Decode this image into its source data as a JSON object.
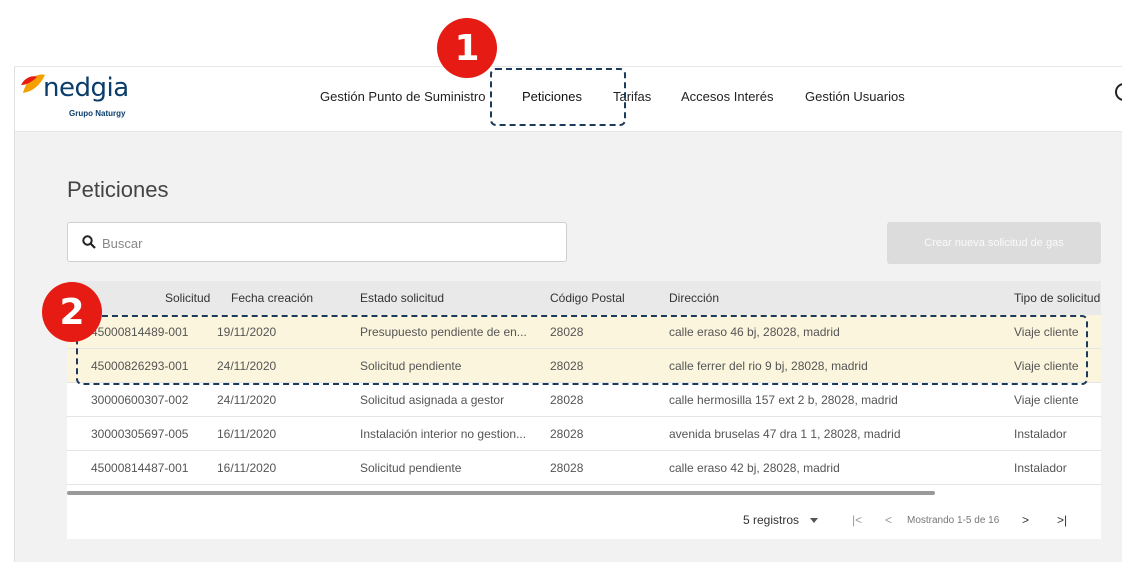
{
  "header": {
    "logo_text": "nedgia",
    "logo_subtext": "Grupo Naturgy",
    "nav": [
      {
        "label": "Gestión Punto de Suministro"
      },
      {
        "label": "Peticiones"
      },
      {
        "label": "Tarifas"
      },
      {
        "label": "Accesos Interés"
      },
      {
        "label": "Gestión Usuarios"
      }
    ],
    "active_nav": "Peticiones"
  },
  "page": {
    "title": "Peticiones",
    "search_placeholder": "Buscar",
    "create_button_label": "Crear nueva solicitud de gas"
  },
  "table": {
    "columns": [
      "Solicitud",
      "Fecha creación",
      "Estado solicitud",
      "Código Postal",
      "Dirección",
      "Tipo de solicitud"
    ],
    "rows": [
      {
        "solicitud": "45000814489-001",
        "fecha": "19/11/2020",
        "estado": "Presupuesto pendiente de en...",
        "cp": "28028",
        "direccion": "calle eraso 46 bj, 28028, madrid",
        "tipo": "Viaje cliente"
      },
      {
        "solicitud": "45000826293-001",
        "fecha": "24/11/2020",
        "estado": "Solicitud pendiente",
        "cp": "28028",
        "direccion": "calle ferrer del rio 9 bj, 28028, madrid",
        "tipo": "Viaje cliente"
      },
      {
        "solicitud": "30000600307-002",
        "fecha": "24/11/2020",
        "estado": "Solicitud asignada a gestor",
        "cp": "28028",
        "direccion": "calle hermosilla 157 ext 2 b, 28028, madrid",
        "tipo": "Viaje cliente"
      },
      {
        "solicitud": "30000305697-005",
        "fecha": "16/11/2020",
        "estado": "Instalación interior no gestion...",
        "cp": "28028",
        "direccion": "avenida bruselas 47 dra 1 1, 28028, madrid",
        "tipo": "Instalador"
      },
      {
        "solicitud": "45000814487-001",
        "fecha": "16/11/2020",
        "estado": "Solicitud pendiente",
        "cp": "28028",
        "direccion": "calle eraso 42 bj, 28028, madrid",
        "tipo": "Instalador"
      }
    ]
  },
  "pagination": {
    "page_size_label": "5 registros",
    "first": "|<",
    "prev": "<",
    "status": "Mostrando 1-5 de 16",
    "next": ">",
    "last": ">|"
  },
  "annotations": {
    "badge_1": "1",
    "badge_2": "2",
    "badge_color": "#e51b14",
    "callout_color": "#1c3a5c",
    "highlight_color": "#fbf5dd"
  },
  "icons": [
    "logo-leaf-icon",
    "search-icon",
    "caret-down-icon",
    "search-partial-icon"
  ]
}
